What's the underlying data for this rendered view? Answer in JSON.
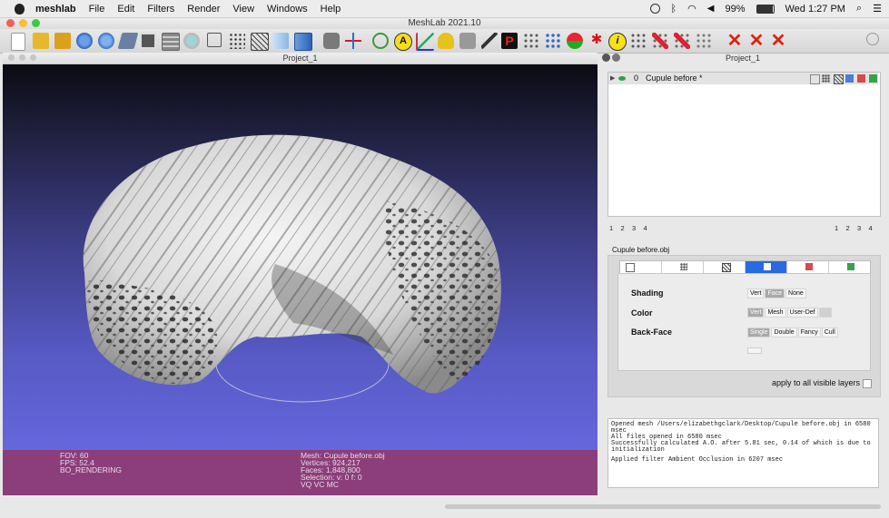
{
  "menubar": {
    "app": "meshlab",
    "items": [
      "File",
      "Edit",
      "Filters",
      "Render",
      "View",
      "Windows",
      "Help"
    ],
    "battery": "99%",
    "clock": "Wed 1:27 PM"
  },
  "window": {
    "title": "MeshLab 2021.10"
  },
  "subwindow": {
    "title": "Project_1"
  },
  "right_panel": {
    "title": "Project_1"
  },
  "layer": {
    "index": "0",
    "name": "Cupule before *"
  },
  "pagers": {
    "left": [
      "1",
      "2",
      "3",
      "4"
    ],
    "right": [
      "1",
      "2",
      "3",
      "4"
    ]
  },
  "props": {
    "mesh_file": "Cupule before.obj",
    "shading": {
      "label": "Shading",
      "options": [
        "Vert",
        "Face",
        "None"
      ],
      "selected": 1
    },
    "color": {
      "label": "Color",
      "options": [
        "Vert",
        "Mesh",
        "User-Def"
      ],
      "selected": 0
    },
    "backface": {
      "label": "Back-Face",
      "options": [
        "Single",
        "Double",
        "Fancy",
        "Cull"
      ],
      "selected": 0
    },
    "apply_all": "apply to all visible layers"
  },
  "info": {
    "fov": "FOV: 60",
    "fps": "FPS:   52.4",
    "rendering": "BO_RENDERING",
    "mesh": "Mesh: Cupule before.obj",
    "vertices": "Vertices: 924,217",
    "faces": "Faces: 1,848,800",
    "selection": "Selection: v: 0 f: 0",
    "flags": "VQ VC MC"
  },
  "log": {
    "lines": [
      "Opened mesh /Users/elizabethgclark/Desktop/Cupule before.obj in 6580",
      "msec",
      "All files opened in 6580 msec",
      "Successfully calculated A.O. after 5.81 sec, 0.14 of which is due to",
      "initialization",
      "",
      "Applied filter Ambient Occlusion in 6207 msec"
    ]
  },
  "icons": [
    "new-project-icon",
    "open-icon",
    "open-project-icon",
    "reload-icon",
    "reload-all-icon",
    "import-icon",
    "snapshot-icon",
    "layers-icon",
    "stereo-icon",
    "bbox-icon",
    "points-icon",
    "wireframe-icon",
    "flat-icon",
    "smooth-icon",
    "trackball-icon",
    "axes-icon",
    "globe-icon",
    "annotate-icon",
    "measure-icon",
    "paint-icon",
    "georef-icon",
    "info-icon",
    "delete-icon",
    "search-icon"
  ]
}
